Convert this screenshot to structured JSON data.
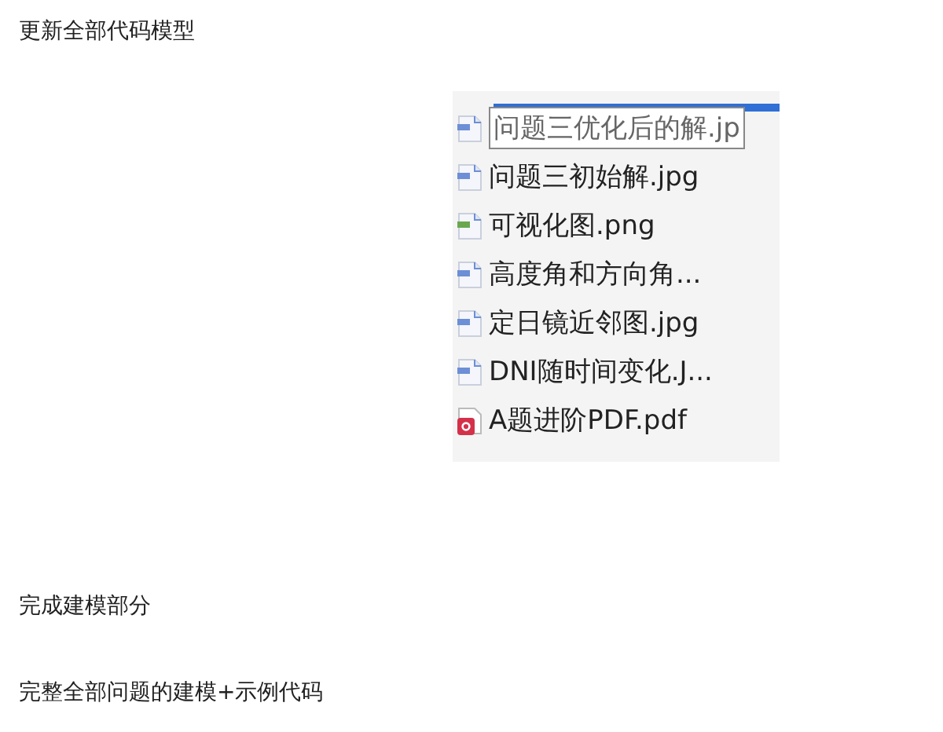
{
  "paragraphs_before": [
    "更新全部代码模型"
  ],
  "file_list": {
    "items": [
      {
        "name": "问题三优化后的解.jp",
        "kind": "jpg",
        "editing": true
      },
      {
        "name": "问题三初始解.jpg",
        "kind": "jpg",
        "editing": false
      },
      {
        "name": "可视化图.png",
        "kind": "png",
        "editing": false
      },
      {
        "name": "高度角和方向角...",
        "kind": "jpg",
        "editing": false
      },
      {
        "name": "定日镜近邻图.jpg",
        "kind": "jpg",
        "editing": false
      },
      {
        "name": "DNI随时间变化.J...",
        "kind": "jpg",
        "editing": false
      },
      {
        "name": "A题进阶PDF.pdf",
        "kind": "pdf",
        "editing": false
      }
    ]
  },
  "paragraphs_after": [
    "完成建模部分",
    "完整全部问题的建模+示例代码"
  ]
}
